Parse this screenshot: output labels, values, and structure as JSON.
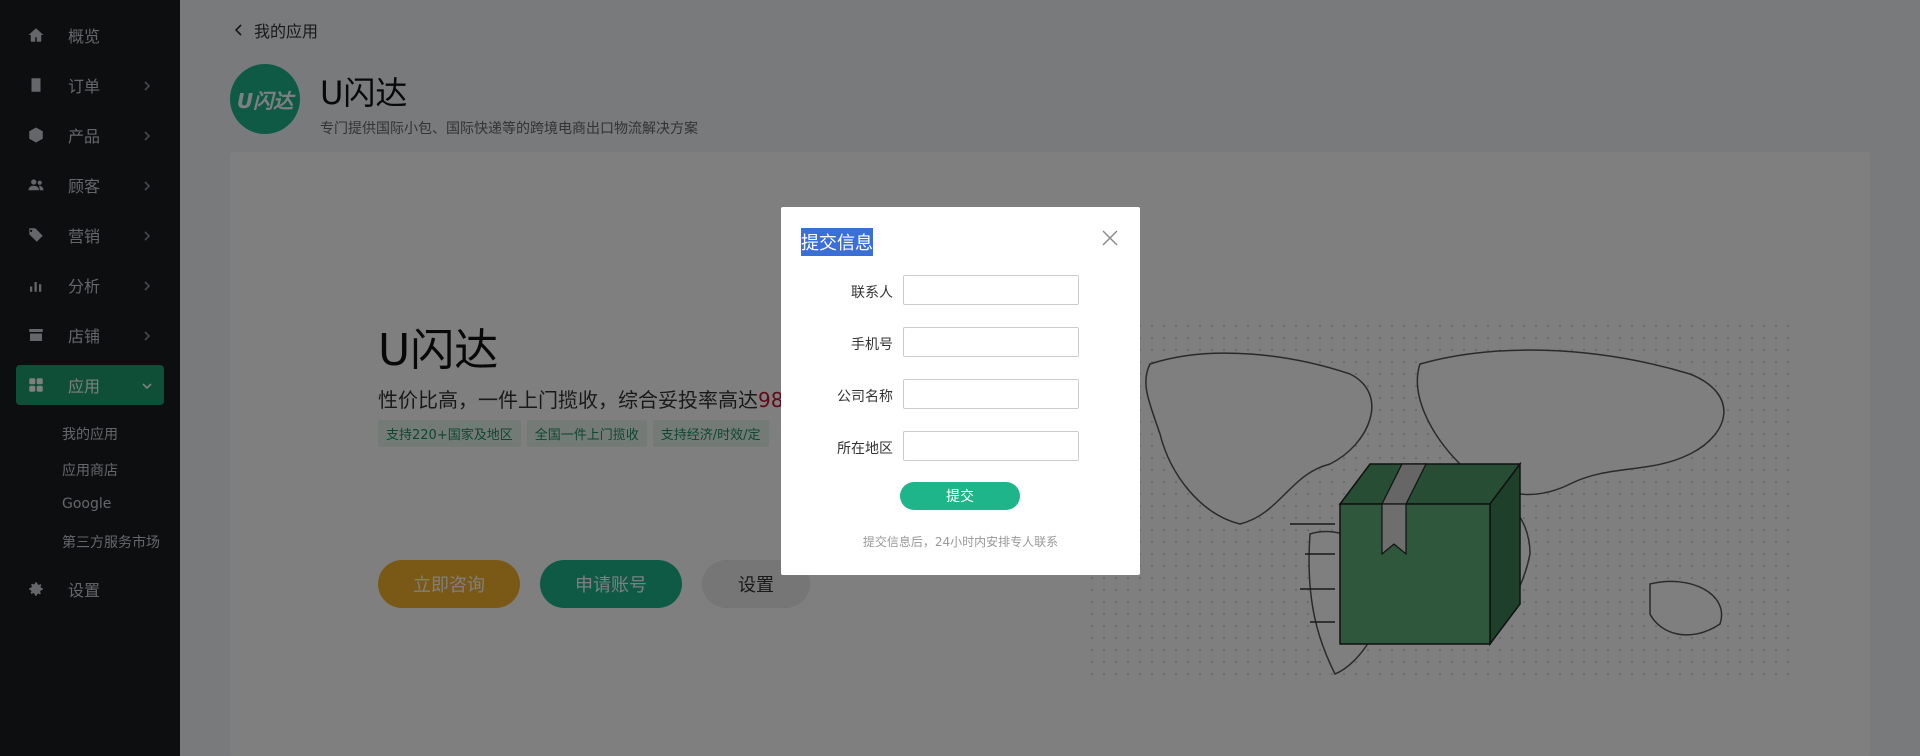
{
  "sidebar": {
    "items": [
      {
        "label": "概览",
        "icon": "home-icon"
      },
      {
        "label": "订单",
        "icon": "clipboard-icon"
      },
      {
        "label": "产品",
        "icon": "box-icon"
      },
      {
        "label": "顾客",
        "icon": "users-icon"
      },
      {
        "label": "营销",
        "icon": "tag-icon"
      },
      {
        "label": "分析",
        "icon": "bar-chart-icon"
      },
      {
        "label": "店铺",
        "icon": "store-icon"
      },
      {
        "label": "应用",
        "icon": "apps-icon"
      }
    ],
    "subitems": [
      "我的应用",
      "应用商店",
      "Google",
      "第三方服务市场"
    ],
    "settings": {
      "label": "设置",
      "icon": "gear-icon"
    }
  },
  "main": {
    "breadcrumb": "我的应用",
    "app": {
      "logo_text": "U闪达",
      "title": "U闪达",
      "description": "专门提供国际小包、国际快递等的跨境电商出口物流解决方案"
    },
    "hero": {
      "title": "U闪达",
      "subtitle_prefix": "性价比高，一件上门揽收，综合妥投率高达",
      "subtitle_highlight": "98",
      "tags": [
        "支持220+国家及地区",
        "全国一件上门揽收",
        "支持经济/时效/定"
      ]
    },
    "buttons": {
      "consult": "立即咨询",
      "apply": "申请账号",
      "settings": "设置"
    }
  },
  "modal": {
    "title": "提交信息",
    "fields": [
      {
        "label": "联系人",
        "value": ""
      },
      {
        "label": "手机号",
        "value": ""
      },
      {
        "label": "公司名称",
        "value": ""
      },
      {
        "label": "所在地区",
        "value": ""
      }
    ],
    "submit_label": "提交",
    "note": "提交信息后，24小时内安排专人联系"
  },
  "colors": {
    "accent": "#1fb58a",
    "consult": "#f4b12a",
    "sidebar_bg": "#1a1d21",
    "highlight": "#c3122f",
    "selection": "#3a6fd8"
  }
}
